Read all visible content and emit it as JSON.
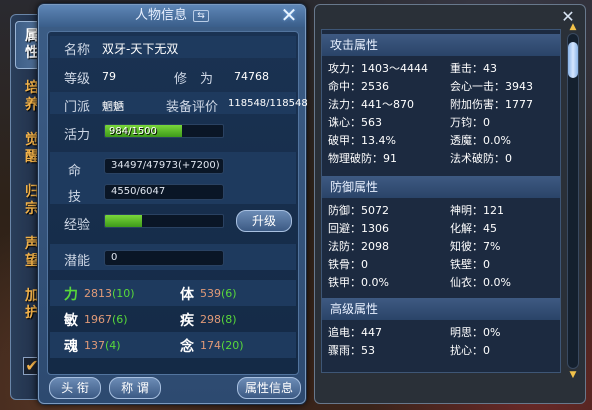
{
  "window": {
    "title": "人物信息",
    "title_icon": "swap-arrows-icon"
  },
  "tabs": [
    {
      "label_1": "属",
      "label_2": "性"
    },
    {
      "label_1": "培",
      "label_2": "养"
    },
    {
      "label_1": "觉",
      "label_2": "醒"
    },
    {
      "label_1": "归",
      "label_2": "宗"
    },
    {
      "label_1": "声",
      "label_2": "望"
    },
    {
      "label_1": "加",
      "label_2": "护"
    }
  ],
  "checkbox": {
    "mark": "✔"
  },
  "character": {
    "name_label": "名称",
    "name": "双牙-天下无双",
    "level_label": "等级",
    "level": "79",
    "cultivation_label": "修　为",
    "cultivation": "74768",
    "sect_label": "门派",
    "sect": "魍魉",
    "equip_label": "装备评价",
    "equip_score": "118548/118548",
    "vitality_label": "活力",
    "vitality": "984/1500",
    "vitality_ratio": 0.656,
    "hp_label": "命",
    "hp": "34497/47973(+7200)",
    "skill_label": "技",
    "skill": "4550/6047",
    "exp_label": "经验",
    "exp_ratio": 0.31,
    "levelup_label": "升级",
    "potential_label": "潜能",
    "potential": "0"
  },
  "stats": [
    {
      "key": "力",
      "key_color": "#58d83a",
      "value": "2813",
      "bonus": "(10)"
    },
    {
      "key": "体",
      "key_color": "#ffffff",
      "value": "539",
      "bonus": "(6)"
    },
    {
      "key": "敏",
      "key_color": "#ffffff",
      "value": "1967",
      "bonus": "(6)"
    },
    {
      "key": "疾",
      "key_color": "#ffffff",
      "value": "298",
      "bonus": "(8)"
    },
    {
      "key": "魂",
      "key_color": "#ffffff",
      "value": "137",
      "bonus": "(4)"
    },
    {
      "key": "念",
      "key_color": "#ffffff",
      "value": "174",
      "bonus": "(20)"
    }
  ],
  "bottom_buttons": {
    "title_btn": "头 衔",
    "appellation_btn": "称 谓",
    "attr_btn": "属性信息"
  },
  "attack": {
    "header": "攻击属性",
    "items": [
      "攻力：1403～4444",
      "重击：43",
      "命中：2536",
      "会心一击：3943",
      "法力：441～870",
      "附加伤害：1777",
      "诛心：563",
      "万钧：0",
      "破甲：13.4%",
      "透魔：0.0%",
      "物理破防：91",
      "法术破防：0"
    ]
  },
  "defense": {
    "header": "防御属性",
    "items": [
      "防御：5072",
      "神明：121",
      "回避：1306",
      "化解：45",
      "法防：2098",
      "知彼：7%",
      "铁骨：0",
      "铁壁：0",
      "铁甲：0.0%",
      "仙衣：0.0%"
    ]
  },
  "advanced": {
    "header": "高级属性",
    "items": [
      "追电：447",
      "明思：0%",
      "骤雨：53",
      "扰心：0"
    ]
  }
}
